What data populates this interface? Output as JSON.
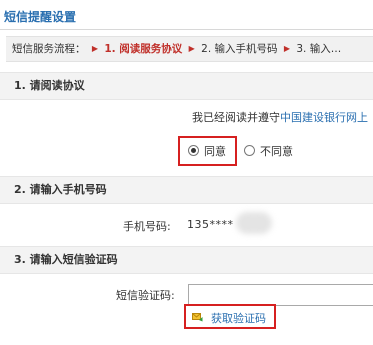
{
  "page": {
    "title": "短信提醒设置"
  },
  "flow": {
    "label": "短信服务流程：",
    "steps": [
      "1. 阅读服务协议",
      "2. 输入手机号码",
      "3. 输入…"
    ],
    "active_index": 0
  },
  "section1": {
    "heading": "1. 请阅读协议",
    "agree_prefix": "我已经阅读并遵守",
    "agree_link": "中国建设银行网上",
    "options": [
      {
        "label": "同意",
        "checked": true
      },
      {
        "label": "不同意",
        "checked": false
      }
    ]
  },
  "section2": {
    "heading": "2. 请输入手机号码",
    "phone_label": "手机号码:",
    "phone_value": "135****"
  },
  "section3": {
    "heading": "3. 请输入短信验证码",
    "code_label": "短信验证码:",
    "code_value": "",
    "get_code_label": "获取验证码"
  },
  "colors": {
    "title_blue": "#2a6fb0",
    "step_red": "#c0302a",
    "highlight_red": "#d62020"
  },
  "icons": {
    "step_arrow": "triangle-right-icon",
    "get_code": "send-icon"
  }
}
